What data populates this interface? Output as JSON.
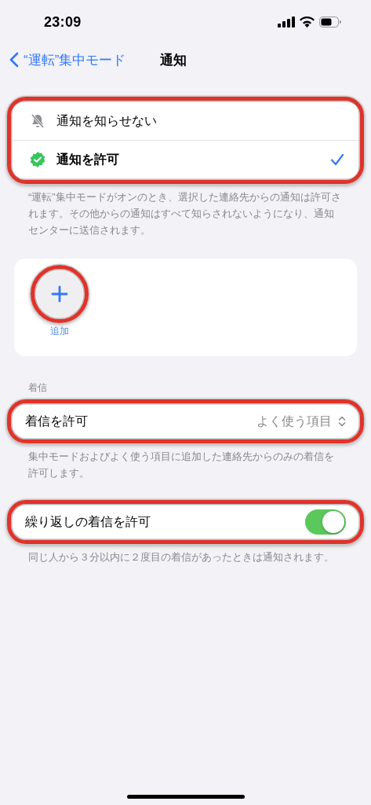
{
  "status_bar": {
    "time": "23:09"
  },
  "nav": {
    "back": "“運転”集中モード",
    "title": "通知"
  },
  "notification_options": [
    {
      "label": "通知を知らせない",
      "kind": "silence",
      "selected": false
    },
    {
      "label": "通知を許可",
      "kind": "allow",
      "selected": true
    }
  ],
  "notification_note": "“運転”集中モードがオンのとき、選択した連絡先からの通知は許可されます。その他からの通知はすべて知らされないようになり、通知センターに送信されます。",
  "add_button": {
    "label": "追加"
  },
  "calls": {
    "header": "着信",
    "allow_calls": {
      "label": "着信を許可",
      "value": "よく使う項目"
    },
    "allow_calls_note": "集中モードおよびよく使う項目に追加した連絡先からのみの着信を許可します。",
    "repeated_calls": {
      "label": "繰り返しの着信を許可",
      "on": true
    },
    "repeated_calls_note": "同じ人から３分以内に２度目の着信があったときは通知されます。"
  }
}
